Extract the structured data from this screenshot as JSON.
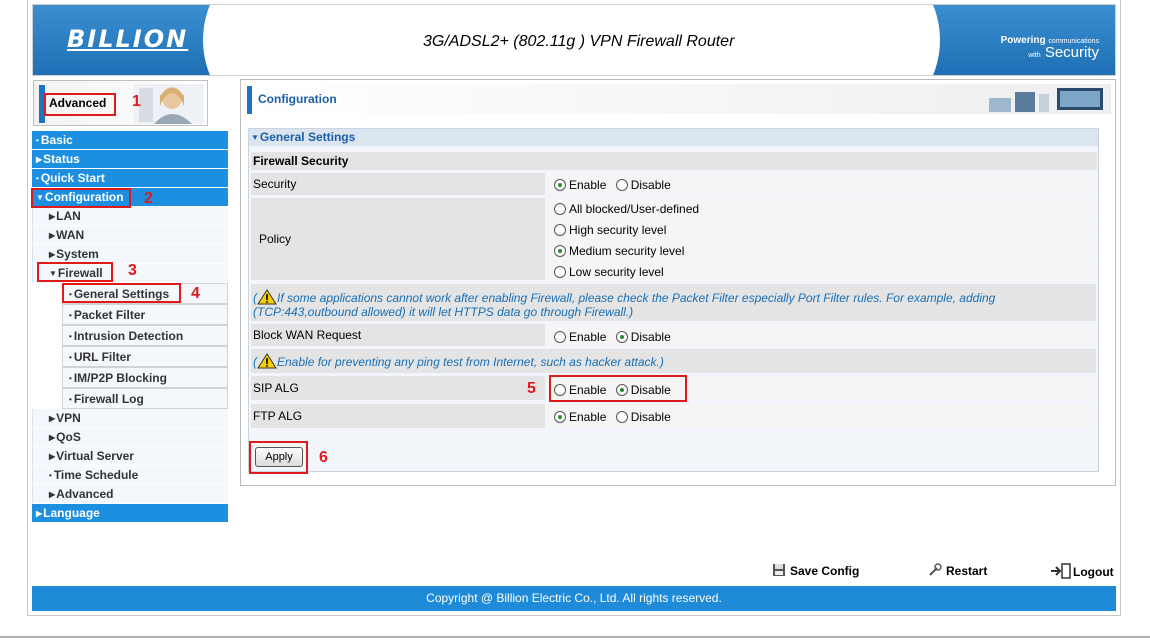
{
  "header": {
    "logo": "BILLION",
    "title": "3G/ADSL2+ (802.11g ) VPN Firewall Router",
    "tagline_main": "Powering",
    "tagline_small": "communications",
    "tagline_with": "with",
    "tagline_security": "Security"
  },
  "sidebar": {
    "mode_label": "Advanced",
    "items": [
      {
        "label": "Basic"
      },
      {
        "label": "Status"
      },
      {
        "label": "Quick Start"
      },
      {
        "label": "Configuration"
      },
      {
        "label": "LAN"
      },
      {
        "label": "WAN"
      },
      {
        "label": "System"
      },
      {
        "label": "Firewall"
      },
      {
        "label": "General Settings"
      },
      {
        "label": "Packet Filter"
      },
      {
        "label": "Intrusion Detection"
      },
      {
        "label": "URL Filter"
      },
      {
        "label": "IM/P2P Blocking"
      },
      {
        "label": "Firewall Log"
      },
      {
        "label": "VPN"
      },
      {
        "label": "QoS"
      },
      {
        "label": "Virtual Server"
      },
      {
        "label": "Time Schedule"
      },
      {
        "label": "Advanced"
      },
      {
        "label": "Language"
      }
    ]
  },
  "content": {
    "page_title": "Configuration",
    "section_title": "General Settings",
    "firewall_security_heading": "Firewall Security",
    "enable_label": "Enable",
    "disable_label": "Disable",
    "security": {
      "label": "Security",
      "value": "Enable"
    },
    "policy": {
      "label": "Policy",
      "options": [
        "All blocked/User-defined",
        "High security level",
        "Medium security level",
        "Low security level"
      ],
      "selected": "Medium security level"
    },
    "firewall_note_line1": "If some applications cannot work after enabling Firewall, please check the Packet Filter especially Port Filter rules. For example, adding",
    "firewall_note_line2": "(TCP:443,outbound allowed) it will let HTTPS data go through Firewall.)",
    "block_wan": {
      "label": "Block WAN Request",
      "value": "Disable"
    },
    "block_wan_note": "Enable for preventing any ping test from Internet, such as hacker attack.)",
    "sip_alg": {
      "label": "SIP ALG",
      "value": "Disable"
    },
    "ftp_alg": {
      "label": "FTP ALG",
      "value": "Enable"
    },
    "apply_label": "Apply"
  },
  "annotations": [
    "1",
    "2",
    "3",
    "4",
    "5",
    "6"
  ],
  "footer": {
    "save_config": "Save Config",
    "restart": "Restart",
    "logout": "Logout",
    "copyright": "Copyright @ Billion Electric Co., Ltd. All rights reserved."
  },
  "colors": {
    "nav_blue": "#1c8fe0",
    "annotation_red": "#e0191c",
    "title_blue": "#1a5fa8"
  }
}
